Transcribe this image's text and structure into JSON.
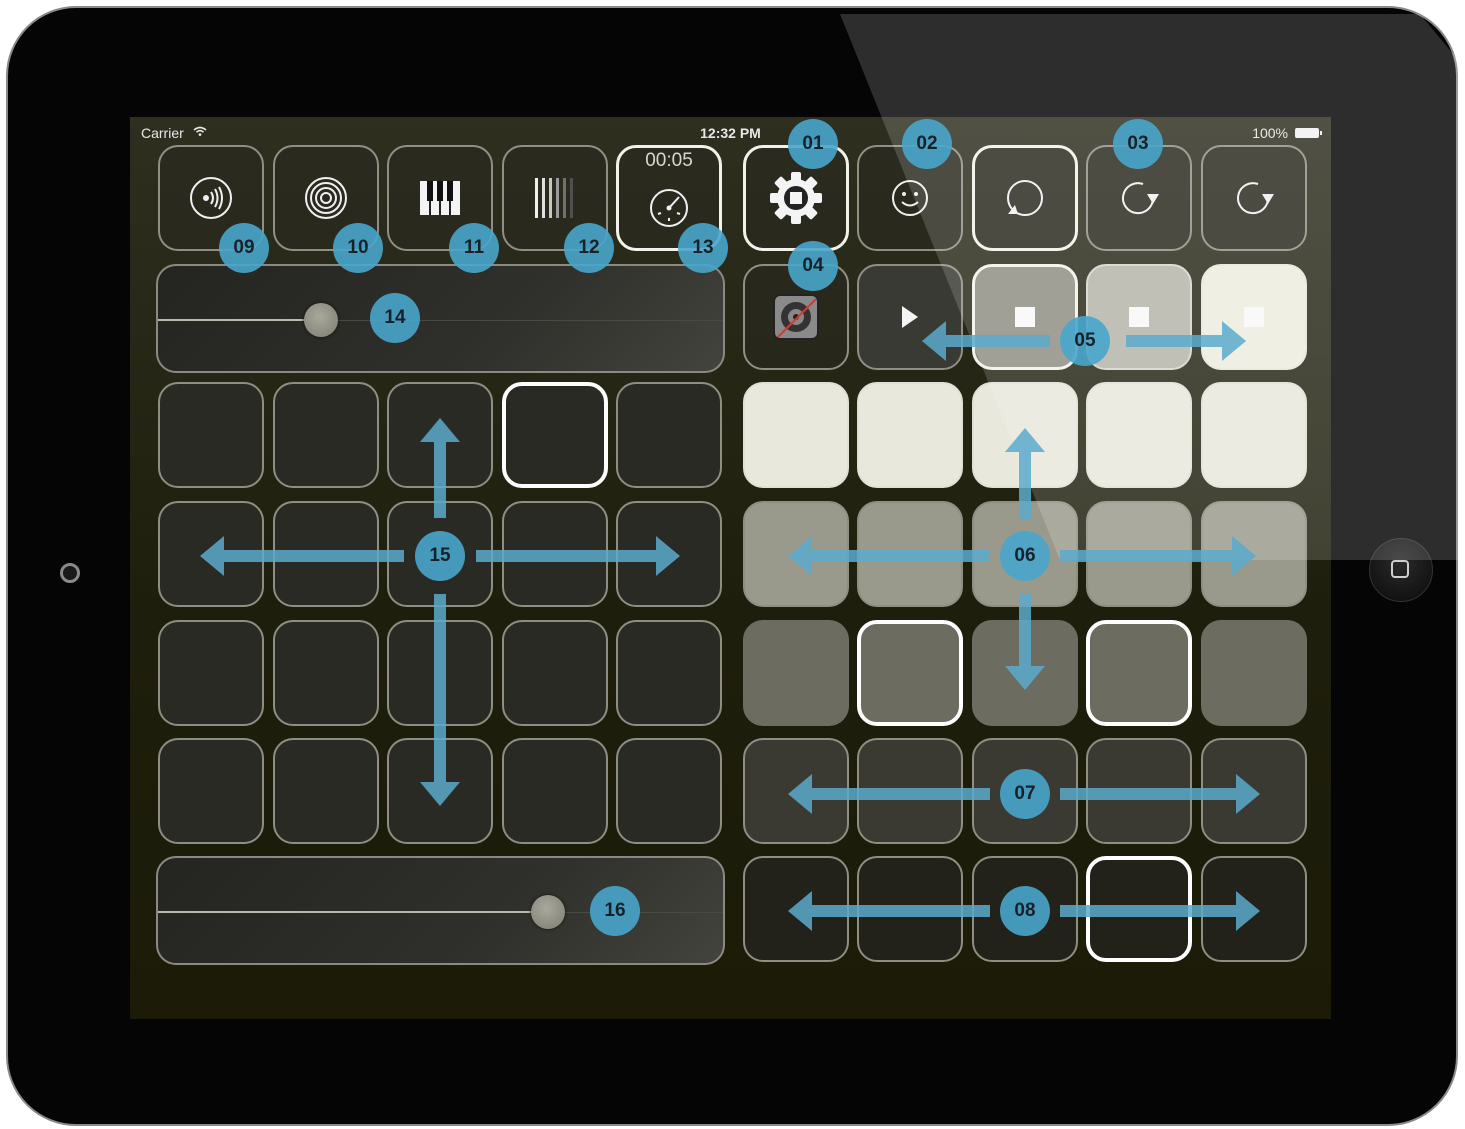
{
  "status_bar": {
    "carrier": "Carrier",
    "time": "12:32 PM",
    "battery": "100%"
  },
  "toolbar": {
    "timer": "00:05",
    "buttons": [
      {
        "name": "speaker-button",
        "icon": "speaker-icon"
      },
      {
        "name": "target-button",
        "icon": "concentric-circles-icon"
      },
      {
        "name": "keyboard-button",
        "icon": "piano-keys-icon"
      },
      {
        "name": "bars-button",
        "icon": "bars-icon"
      },
      {
        "name": "metronome-button",
        "icon": "dial-icon"
      },
      {
        "name": "stop-gear-button",
        "icon": "gear-stop-icon"
      },
      {
        "name": "smiley-button",
        "icon": "smiley-icon"
      },
      {
        "name": "loop-button",
        "icon": "loop-icon"
      },
      {
        "name": "redo-button-1",
        "icon": "redo-icon"
      },
      {
        "name": "redo-button-2",
        "icon": "redo-icon"
      }
    ]
  },
  "transport_row": {
    "icons": [
      "no-output-icon",
      "play-icon",
      "stop-icon",
      "stop-icon",
      "stop-icon"
    ]
  },
  "sliders": {
    "top_level": 0.28,
    "bottom_level": 0.68
  },
  "pad_colors": {
    "dark": "#2a2a24",
    "light": "#e8e8dc",
    "mid": "#9a9a8c",
    "dim": "#6c6c60",
    "transport_dark": "#3a3a34",
    "transport_mid": "#8e8e84",
    "transport_light": "#b4b4aa",
    "transport_white": "#ececdf"
  },
  "annotations": {
    "b01": "01",
    "b02": "02",
    "b03": "03",
    "b04": "04",
    "b05": "05",
    "b06": "06",
    "b07": "07",
    "b08": "08",
    "b09": "09",
    "b10": "10",
    "b11": "11",
    "b12": "12",
    "b13": "13",
    "b14": "14",
    "b15": "15",
    "b16": "16",
    "color": "#48a6cc"
  }
}
